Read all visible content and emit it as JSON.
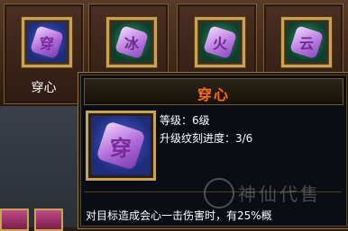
{
  "skills": [
    {
      "glyph": "穿",
      "label": "穿心",
      "theme": "purple"
    },
    {
      "glyph": "冰",
      "label": "",
      "theme": "teal"
    },
    {
      "glyph": "火",
      "label": "",
      "theme": "teal"
    },
    {
      "glyph": "云",
      "label": "",
      "theme": "teal"
    }
  ],
  "tooltip": {
    "title": "穿心",
    "icon_glyph": "穿",
    "level_text": "等级：6级",
    "progress_text": "升级纹刻进度：3/6",
    "description": "对目标造成会心一击伤害时，有25%概"
  },
  "watermark": {
    "text": "神仙代售"
  },
  "colors": {
    "title": "#ff6a1a",
    "frame_gold": "#c9a252",
    "text": "#ffffff"
  }
}
